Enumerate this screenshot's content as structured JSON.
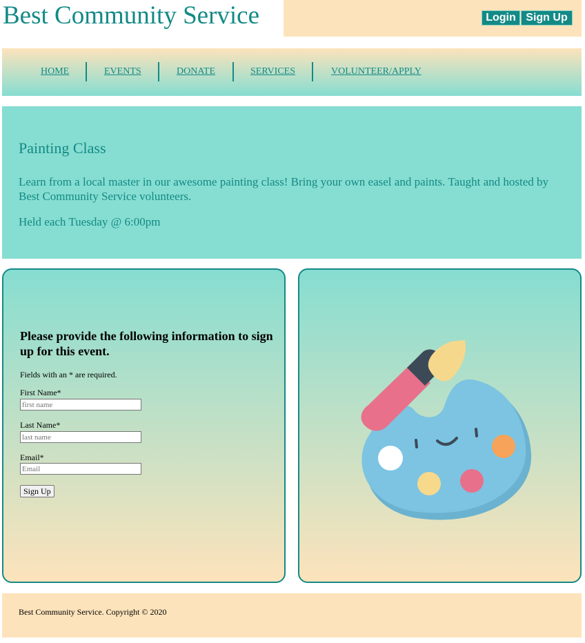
{
  "header": {
    "title": "Best Community Service",
    "login_label": "Login",
    "signup_label": "Sign Up"
  },
  "nav": {
    "items": [
      "HOME",
      "EVENTS",
      "DONATE",
      "SERVICES",
      "VOLUNTEER/APPLY"
    ]
  },
  "event": {
    "title": "Painting Class",
    "description": "Learn from a local master in our awesome painting class! Bring your own easel and paints. Taught and hosted by Best Community Service volunteers.",
    "schedule": "Held each Tuesday @ 6:00pm"
  },
  "form": {
    "heading": "Please provide the following information to sign up for this event.",
    "note": "Fields with an * are required.",
    "first_name": {
      "label": "First Name*",
      "value": "",
      "placeholder": "first name"
    },
    "last_name": {
      "label": "Last Name*",
      "value": "",
      "placeholder": "last name"
    },
    "email": {
      "label": "Email*",
      "value": "",
      "placeholder": "Email"
    },
    "submit_label": "Sign Up"
  },
  "image": {
    "icon": "paint-palette-icon"
  },
  "footer": {
    "text": "Best Community Service. Copyright © 2020"
  },
  "colors": {
    "teal": "#138a86",
    "mint": "#86ddd1",
    "peach": "#fde3bb"
  }
}
